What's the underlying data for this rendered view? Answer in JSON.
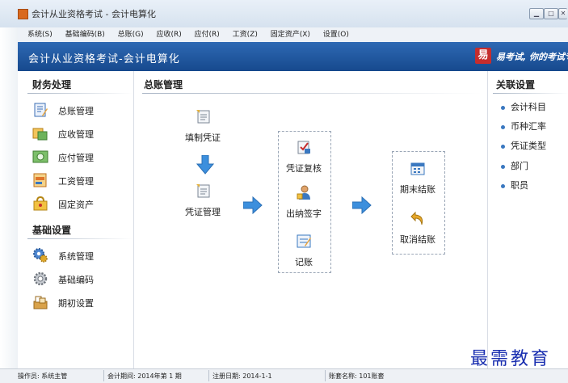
{
  "window": {
    "title": "会计从业资格考试 - 会计电算化",
    "controls": [
      "minimize",
      "maximize",
      "close"
    ]
  },
  "menu": [
    "系统(S)",
    "基础编码(B)",
    "总账(G)",
    "应收(R)",
    "应付(R)",
    "工资(Z)",
    "固定资产(X)",
    "设置(O)"
  ],
  "banner": {
    "title": "会计从业资格考试-会计电算化",
    "logo": "易",
    "slogan": "易考试, 你的考试专"
  },
  "sidebar": {
    "finance": {
      "title": "财务处理",
      "items": [
        {
          "label": "总账管理",
          "icon": "ledger-icon",
          "color": "#3d6fb5"
        },
        {
          "label": "应收管理",
          "icon": "receivable-icon",
          "color": "#d59a2b"
        },
        {
          "label": "应付管理",
          "icon": "payable-icon",
          "color": "#5aa04a"
        },
        {
          "label": "工资管理",
          "icon": "payroll-icon",
          "color": "#e0752a"
        },
        {
          "label": "固定资产",
          "icon": "fixed-asset-icon",
          "color": "#e0a92a"
        }
      ]
    },
    "basic": {
      "title": "基础设置",
      "items": [
        {
          "label": "系统管理",
          "icon": "system-gear-icon",
          "color": "#3d74c0"
        },
        {
          "label": "基础编码",
          "icon": "settings-gear-icon",
          "color": "#8a8f96"
        },
        {
          "label": "期初设置",
          "icon": "opening-setup-icon",
          "color": "#c98a2c"
        }
      ]
    }
  },
  "main": {
    "title": "总账管理",
    "steps": {
      "fill_voucher": "填制凭证",
      "voucher_manage": "凭证管理",
      "voucher_review": "凭证复核",
      "cashier_sign": "出纳签字",
      "post": "记账",
      "period_close": "期末结账",
      "cancel_close": "取消结账"
    }
  },
  "related": {
    "title": "关联设置",
    "items": [
      "会计科目",
      "币种汇率",
      "凭证类型",
      "部门",
      "职员"
    ]
  },
  "status": {
    "operator": "操作员: 系统主管",
    "period": "会计期间: 2014年第 1 期",
    "reg_date": "注册日期: 2014-1-1",
    "account_set": "账套名称: 101账套"
  },
  "watermark": "最需教育",
  "colors": {
    "banner": "#1f5aa3",
    "arrow": "#3c8fdd",
    "accent": "#3a78c0"
  }
}
